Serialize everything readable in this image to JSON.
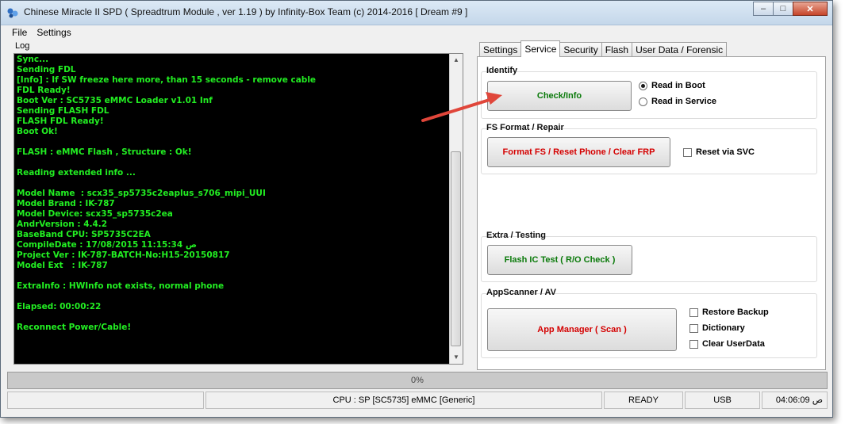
{
  "window": {
    "title": "Chinese Miracle II SPD ( Spreadtrum Module , ver 1.19 ) by Infinity-Box Team (c) 2014-2016 [ Dream #9 ]",
    "controls": {
      "minimize": "‒",
      "maximize": "□",
      "close": "✕"
    }
  },
  "menu": {
    "file": "File",
    "settings": "Settings"
  },
  "log": {
    "label": "Log",
    "text_color": "#22ee22",
    "lines": [
      "Sync...",
      "Sending FDL",
      "[Info] : If SW freeze here more, than 15 seconds - remove cable",
      "FDL Ready!",
      "Boot Ver : SC5735 eMMC Loader v1.01 Inf",
      "Sending FLASH FDL",
      "FLASH FDL Ready!",
      "Boot Ok!",
      "",
      "FLASH : eMMC Flash , Structure : Ok!",
      "",
      "Reading extended info ...",
      "",
      "Model Name  : scx35_sp5735c2eaplus_s706_mipi_UUI",
      "Model Brand : IK-787",
      "Model Device: scx35_sp5735c2ea",
      "AndrVersion : 4.4.2",
      "BaseBand CPU: SP5735C2EA",
      "CompileDate : 17/08/2015 11:15:34 ص",
      "Project Ver : IK-787-BATCH-No:H15-20150817",
      "Model Ext   : IK-787",
      "",
      "ExtraInfo : HWInfo not exists, normal phone",
      "",
      "Elapsed: 00:00:22",
      "",
      "Reconnect Power/Cable!"
    ]
  },
  "tabs": [
    "Settings",
    "Service",
    "Security",
    "Flash",
    "User Data / Forensic"
  ],
  "active_tab": "Service",
  "service": {
    "identify": {
      "label": "Identify",
      "button": "Check/Info",
      "radio_boot": "Read in Boot",
      "radio_service": "Read in Service",
      "selected": "Read in Boot"
    },
    "fs": {
      "label": "FS Format / Repair",
      "button": "Format FS / Reset Phone / Clear FRP",
      "checkbox": "Reset via SVC"
    },
    "extra": {
      "label": "Extra / Testing",
      "button": "Flash IC Test ( R/O Check )"
    },
    "appscanner": {
      "label": "AppScanner / AV",
      "button": "App Manager ( Scan )",
      "checkboxes": [
        "Restore Backup",
        "Dictionary",
        "Clear UserData"
      ]
    }
  },
  "progress": {
    "text": "0%",
    "value": 0
  },
  "status": {
    "cpu": "CPU : SP [SC5735] eMMC [Generic]",
    "state": "READY",
    "conn": "USB",
    "time": "04:06:09 ص"
  },
  "colors": {
    "accent_green": "#0a7a0a",
    "accent_red": "#d40000",
    "annotation_arrow": "#e0463a"
  }
}
